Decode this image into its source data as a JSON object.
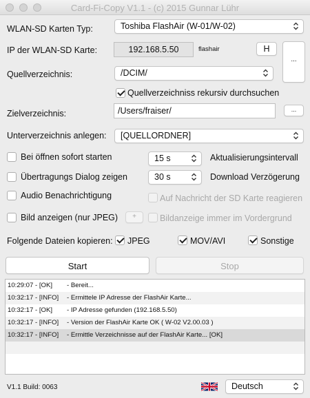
{
  "window": {
    "title": "Card-Fi-Copy V1.1 - (c) 2015 Gunnar Lühr"
  },
  "card_type": {
    "label": "WLAN-SD Karten Typ:",
    "value": "Toshiba FlashAir (W-01/W-02)"
  },
  "ip": {
    "label": "IP der WLAN-SD Karte:",
    "value": "192.168.5.50",
    "hostname": "flashair",
    "h_button": "H",
    "browse_button": "..."
  },
  "source": {
    "label": "Quellverzeichnis:",
    "value": "/DCIM/",
    "recursive_label": "Quellverzeichniss rekursiv durchsuchen",
    "recursive_checked": true
  },
  "target": {
    "label": "Zielverzeichnis:",
    "value": "/Users/fraiser/",
    "browse_button": "..."
  },
  "subdir": {
    "label": "Unterverzeichnis anlegen:",
    "value": "[QUELLORDNER]"
  },
  "options": {
    "start_on_open": {
      "label": "Bei öffnen sofort starten",
      "checked": false
    },
    "show_dialog": {
      "label": "Übertragungs Dialog zeigen",
      "checked": false
    },
    "audio": {
      "label": "Audio Benachrichtigung",
      "checked": false
    },
    "show_image": {
      "label": "Bild anzeigen (nur JPEG)",
      "checked": false,
      "plus_button": "+"
    },
    "update_interval": {
      "value": "15 s",
      "label": "Aktualisierungsintervall"
    },
    "download_delay": {
      "value": "30 s",
      "label": "Download Verzögerung"
    },
    "sd_notify": {
      "label": "Auf Nachricht der SD Karte reagieren",
      "checked": false,
      "disabled": true
    },
    "image_front": {
      "label": "Bildanzeige immer im Vordergrund",
      "checked": false,
      "disabled": true
    }
  },
  "copy_files": {
    "label": "Folgende Dateien kopieren:",
    "jpeg": {
      "label": "JPEG",
      "checked": true
    },
    "movavi": {
      "label": "MOV/AVI",
      "checked": true
    },
    "other": {
      "label": "Sonstige",
      "checked": true
    }
  },
  "actions": {
    "start": "Start",
    "stop": "Stop"
  },
  "log": [
    {
      "time": "10:29:07 - [OK]",
      "message": "- Bereit..."
    },
    {
      "time": "10:32:17 - [INFO]",
      "message": "- Ermittele IP Adresse der FlashAir Karte..."
    },
    {
      "time": "10:32:17 - [OK]",
      "message": "- IP Adresse gefunden (192.168.5.50)"
    },
    {
      "time": "10:32:17 - [INFO]",
      "message": "- Version der FlashAir Karte OK ( W-02 V2.00.03 )"
    },
    {
      "time": "10:32:17 - [INFO]",
      "message": "- Ermittle Verzeichnisse auf der FlashAir Karte... [OK]"
    }
  ],
  "footer": {
    "build": "V1.1 Build: 0063",
    "language": "Deutsch",
    "flag_icon": "uk-flag-icon"
  }
}
